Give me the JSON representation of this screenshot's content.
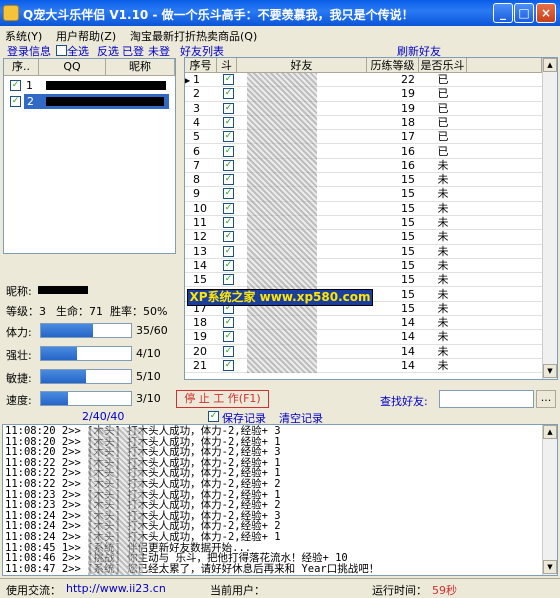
{
  "window": {
    "title": "Q宠大斗乐伴侣 V1.10 - 做一个乐斗高手：不要羡慕我，我只是个传说！",
    "btn_min": "_",
    "btn_max": "□",
    "btn_close": "×"
  },
  "menu": [
    "系统(Y)",
    "用户帮助(Z)",
    "淘宝最新打折热卖商品(Q)"
  ],
  "toolbar": {
    "login": "登录信息",
    "select_all": "全选",
    "invert": "反选",
    "logged": "已登",
    "not_logged": "未登",
    "friend_list": "好友列表",
    "refresh": "刷新好友"
  },
  "accounts": {
    "headers": [
      "序..",
      "QQ",
      "昵称"
    ],
    "rows": [
      {
        "index": "1",
        "checked": true
      },
      {
        "index": "2",
        "checked": true,
        "selected": true
      }
    ]
  },
  "friends": {
    "headers": [
      "序号",
      "斗",
      "好友",
      "历练等级",
      "是否乐斗"
    ],
    "rows": [
      {
        "n": "1",
        "lvl": "22",
        "st": "已"
      },
      {
        "n": "2",
        "lvl": "19",
        "st": "已"
      },
      {
        "n": "3",
        "lvl": "19",
        "st": "已"
      },
      {
        "n": "4",
        "lvl": "18",
        "st": "已"
      },
      {
        "n": "5",
        "lvl": "17",
        "st": "已"
      },
      {
        "n": "6",
        "lvl": "16",
        "st": "已"
      },
      {
        "n": "7",
        "lvl": "16",
        "st": "未"
      },
      {
        "n": "8",
        "lvl": "15",
        "st": "未"
      },
      {
        "n": "9",
        "lvl": "15",
        "st": "未"
      },
      {
        "n": "10",
        "lvl": "15",
        "st": "未"
      },
      {
        "n": "11",
        "lvl": "15",
        "st": "未"
      },
      {
        "n": "12",
        "lvl": "15",
        "st": "未"
      },
      {
        "n": "13",
        "lvl": "15",
        "st": "未"
      },
      {
        "n": "14",
        "lvl": "15",
        "st": "未"
      },
      {
        "n": "15",
        "lvl": "15",
        "st": "未"
      },
      {
        "n": "16",
        "lvl": "15",
        "st": "未"
      },
      {
        "n": "17",
        "lvl": "15",
        "st": "未"
      },
      {
        "n": "18",
        "lvl": "14",
        "st": "未"
      },
      {
        "n": "19",
        "lvl": "14",
        "st": "未"
      },
      {
        "n": "20",
        "lvl": "14",
        "st": "未"
      },
      {
        "n": "21",
        "lvl": "14",
        "st": "未"
      }
    ]
  },
  "watermark": "XP系统之家 www.xp580.com",
  "stats": {
    "nick_label": "昵称:",
    "level": "等级：3",
    "life": "生命：71",
    "winrate": "胜率：50%",
    "items": [
      {
        "label": "体力:",
        "value": "35/60",
        "fraction": 0.583
      },
      {
        "label": "强壮:",
        "value": "4/10",
        "fraction": 0.4
      },
      {
        "label": "敏捷:",
        "value": "5/10",
        "fraction": 0.5
      },
      {
        "label": "速度:",
        "value": "3/10",
        "fraction": 0.3
      }
    ]
  },
  "controls": {
    "stop": "停 止 工 作(F1)",
    "find": "查找好友:",
    "find_btn": "..."
  },
  "logbar": {
    "count": "2/40/40",
    "save": "保存记录",
    "clear": "清空记录"
  },
  "log": [
    "11:08:20  2>>          [木头] 打木头人成功，体力-2,经验+ 3",
    "11:08:20  2>>          [木头] 打木头人成功，体力-2,经验+ 1",
    "11:08:20  2>>          [木头] 打木头人成功，体力-2,经验+ 3",
    "11:08:22  2>>          [木头] 打木头人成功，体力-2,经验+ 1",
    "11:08:22  2>>          [木头] 打木头人成功，体力-2,经验+ 1",
    "11:08:22  2>>          [木头] 打木头人成功，体力-2,经验+ 2",
    "11:08:23  2>>          [木头] 打木头人成功，体力-2,经验+ 1",
    "11:08:23  2>>          [木头] 打木头人成功，体力-2,经验+ 2",
    "11:08:24  2>>          [木头] 打木头人成功，体力-2,经验+ 3",
    "11:08:24  2>>          [木头] 打木头人成功，体力-2,经验+ 2",
    "11:08:24  2>>          [木头] 打木头人成功，体力-2,经验+ 1",
    "11:08:45  1>>          [系统] 伴侣更新好友数据开始...",
    "11:08:46  2>>          [挑战] 你主动与         乐斗，把他打得落花流水！经验+ 10",
    "11:08:47  2>>          [系统] 您已经太累了，请好好休息后再来和      Year口挑战吧！"
  ],
  "status": {
    "link_label": "使用交流：",
    "link": "http://www.ii23.cn",
    "user_label": "当前用户：",
    "time_label": "运行时间：",
    "time": "59秒"
  }
}
